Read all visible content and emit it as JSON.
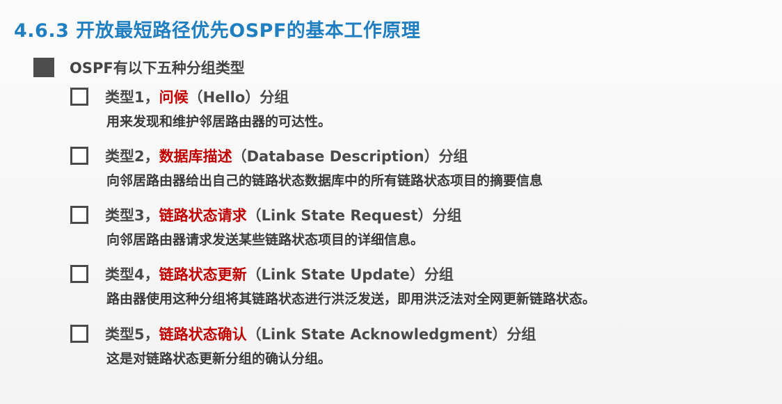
{
  "title": "4.6.3 开放最短路径优先OSPF的基本工作原理",
  "heading": "OSPF有以下五种分组类型",
  "items": [
    {
      "prefix": "类型1，",
      "name": "问候",
      "suffix": "（Hello）分组",
      "description": "用来发现和维护邻居路由器的可达性。"
    },
    {
      "prefix": "类型2，",
      "name": "数据库描述",
      "suffix": "（Database Description）分组",
      "description": "向邻居路由器给出自己的链路状态数据库中的所有链路状态项目的摘要信息"
    },
    {
      "prefix": "类型3，",
      "name": "链路状态请求",
      "suffix": "（Link State Request）分组",
      "description": "向邻居路由器请求发送某些链路状态项目的详细信息。"
    },
    {
      "prefix": "类型4，",
      "name": "链路状态更新",
      "suffix": "（Link State Update）分组",
      "description": "路由器使用这种分组将其链路状态进行洪泛发送，即用洪泛法对全网更新链路状态。"
    },
    {
      "prefix": "类型5，",
      "name": "链路状态确认",
      "suffix": "（Link State Acknowledgment）分组",
      "description": "这是对链路状态更新分组的确认分组。"
    }
  ],
  "colors": {
    "title": "#1f7fc1",
    "highlight": "#c00000",
    "text": "#3a3a3a"
  }
}
